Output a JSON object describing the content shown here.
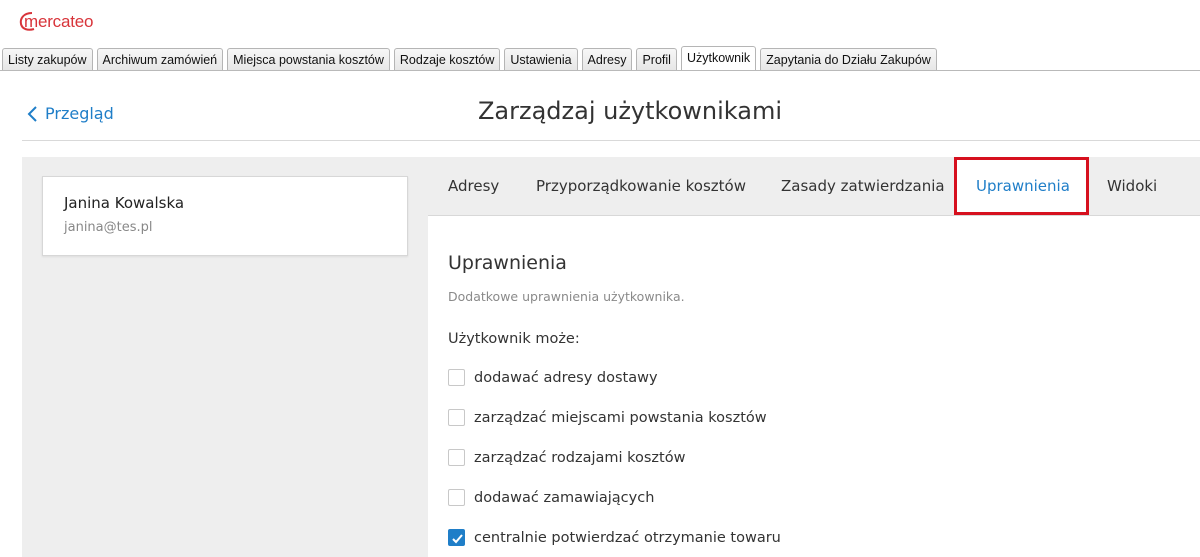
{
  "brand": {
    "logo_text": "mercateo",
    "accent": "#d8343a"
  },
  "top_tabs": [
    {
      "label": "Listy zakupów",
      "active": false
    },
    {
      "label": "Archiwum zamówień",
      "active": false
    },
    {
      "label": "Miejsca powstania kosztów",
      "active": false
    },
    {
      "label": "Rodzaje kosztów",
      "active": false
    },
    {
      "label": "Ustawienia",
      "active": false
    },
    {
      "label": "Adresy",
      "active": false
    },
    {
      "label": "Profil",
      "active": false
    },
    {
      "label": "Użytkownik",
      "active": true
    },
    {
      "label": "Zapytania do Działu Zakupów",
      "active": false
    }
  ],
  "header": {
    "back_label": "Przegląd",
    "title": "Zarządzaj użytkownikami"
  },
  "user": {
    "name": "Janina Kowalska",
    "email": "janina@tes.pl"
  },
  "sub_tabs": [
    {
      "label": "Adresy",
      "active": false
    },
    {
      "label": "Przyporządkowanie kosztów",
      "active": false
    },
    {
      "label": "Zasady zatwierdzania",
      "active": false
    },
    {
      "label": "Uprawnienia",
      "active": true
    },
    {
      "label": "Widoki",
      "active": false
    }
  ],
  "permissions": {
    "title": "Uprawnienia",
    "description": "Dodatkowe uprawnienia użytkownika.",
    "intro": "Użytkownik może:",
    "items": [
      {
        "label": "dodawać adresy dostawy",
        "checked": false
      },
      {
        "label": "zarządzać miejscami powstania kosztów",
        "checked": false
      },
      {
        "label": "zarządzać rodzajami kosztów",
        "checked": false
      },
      {
        "label": "dodawać zamawiających",
        "checked": false
      },
      {
        "label": "centralnie potwierdzać otrzymanie towaru",
        "checked": true
      }
    ]
  },
  "colors": {
    "link_blue": "#1f7ec8",
    "highlight_red": "#d6101e",
    "panel_gray": "#eeeeee"
  }
}
